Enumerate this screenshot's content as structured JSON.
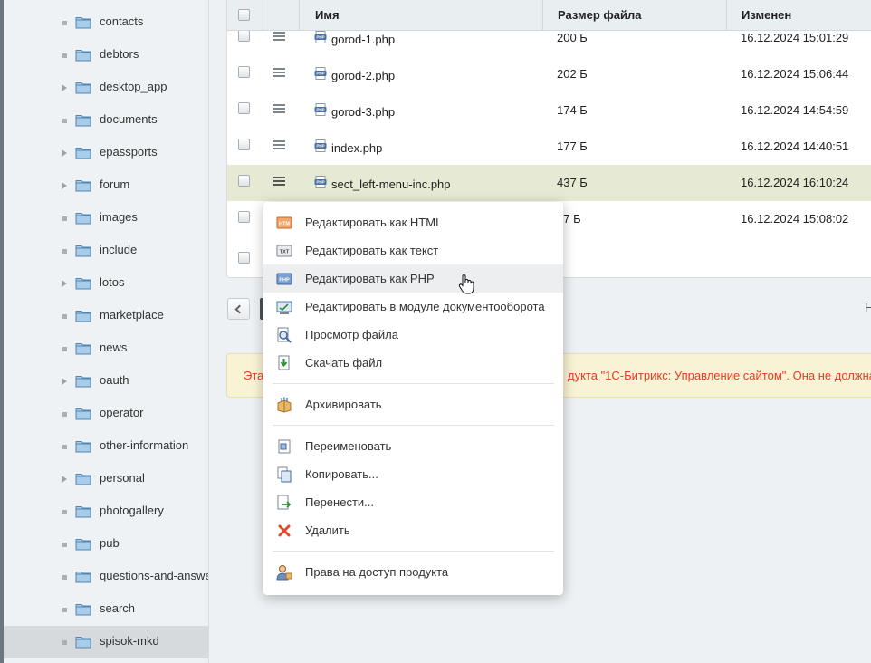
{
  "sidebar": {
    "items": [
      {
        "label": "contacts",
        "marker": "dot"
      },
      {
        "label": "debtors",
        "marker": "dot"
      },
      {
        "label": "desktop_app",
        "marker": "arrow"
      },
      {
        "label": "documents",
        "marker": "dot"
      },
      {
        "label": "epassports",
        "marker": "arrow"
      },
      {
        "label": "forum",
        "marker": "arrow"
      },
      {
        "label": "images",
        "marker": "dot"
      },
      {
        "label": "include",
        "marker": "dot"
      },
      {
        "label": "lotos",
        "marker": "arrow"
      },
      {
        "label": "marketplace",
        "marker": "dot"
      },
      {
        "label": "news",
        "marker": "dot"
      },
      {
        "label": "oauth",
        "marker": "arrow"
      },
      {
        "label": "operator",
        "marker": "dot"
      },
      {
        "label": "other-information",
        "marker": "dot"
      },
      {
        "label": "personal",
        "marker": "arrow"
      },
      {
        "label": "photogallery",
        "marker": "dot"
      },
      {
        "label": "pub",
        "marker": "dot"
      },
      {
        "label": "questions-and-answe",
        "marker": "dot"
      },
      {
        "label": "search",
        "marker": "dot"
      },
      {
        "label": "spisok-mkd",
        "marker": "dot",
        "selected": true
      }
    ]
  },
  "grid": {
    "columns": {
      "name": "Имя",
      "size": "Размер файла",
      "modified": "Изменен"
    },
    "rows": [
      {
        "name": "gorod-1.php",
        "size": "200 Б",
        "modified": "16.12.2024 15:01:29"
      },
      {
        "name": "gorod-2.php",
        "size": "202 Б",
        "modified": "16.12.2024 15:06:44"
      },
      {
        "name": "gorod-3.php",
        "size": "174 Б",
        "modified": "16.12.2024 14:54:59"
      },
      {
        "name": "index.php",
        "size": "177 Б",
        "modified": "16.12.2024 14:40:51"
      },
      {
        "name": "sect_left-menu-inc.php",
        "size": "437 Б",
        "modified": "16.12.2024 16:10:24",
        "highlighted": true
      },
      {
        "name": "",
        "size": "07 Б",
        "modified": "16.12.2024 15:08:02"
      }
    ]
  },
  "pager": {
    "right_text": "Н"
  },
  "notice": {
    "text_left": "Эта",
    "text_right": "дукта \"1С-Битрикс: Управление сайтом\". Она не должна"
  },
  "context_menu": {
    "items": [
      {
        "label": "Редактировать как HTML",
        "icon": "html-edit-icon"
      },
      {
        "label": "Редактировать как текст",
        "icon": "text-edit-icon"
      },
      {
        "label": "Редактировать как PHP",
        "icon": "php-edit-icon",
        "hover": true
      },
      {
        "label": "Редактировать в модуле документооборота",
        "icon": "workflow-edit-icon"
      },
      {
        "label": "Просмотр файла",
        "icon": "view-file-icon"
      },
      {
        "label": "Скачать файл",
        "icon": "download-icon"
      },
      {
        "label": "Архивировать",
        "icon": "archive-icon"
      },
      {
        "label": "Переименовать",
        "icon": "rename-icon"
      },
      {
        "label": "Копировать...",
        "icon": "copy-icon"
      },
      {
        "label": "Перенести...",
        "icon": "move-icon"
      },
      {
        "label": "Удалить",
        "icon": "delete-icon"
      },
      {
        "label": "Права на доступ продукта",
        "icon": "access-rights-icon"
      }
    ]
  },
  "colors": {
    "accent_hover_row": "#e6e9d3",
    "notice_text": "#e53b23",
    "selected_tree": "#d6dadd"
  }
}
